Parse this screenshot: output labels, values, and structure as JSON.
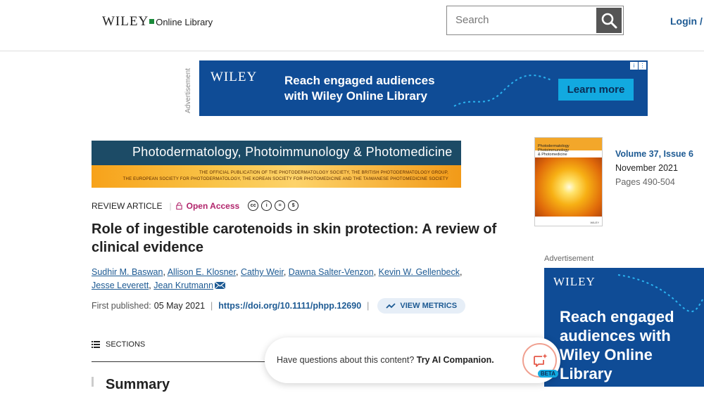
{
  "header": {
    "logo_wiley": "WILEY",
    "logo_sub": "Online Library",
    "search_placeholder": "Search",
    "login": "Login / R"
  },
  "ads": {
    "vertical_label": "Advertisement",
    "top": {
      "brand": "WILEY",
      "headline_line1": "Reach engaged audiences",
      "headline_line2": "with Wiley Online Library",
      "cta": "Learn more"
    },
    "side_label": "Advertisement",
    "side": {
      "brand": "WILEY",
      "headline_line1": "Reach engaged",
      "headline_line2": "audiences with",
      "headline_line3": "Wiley Online",
      "headline_line4": "Library"
    }
  },
  "journal": {
    "banner_title": "Photodermatology, Photoimmunology & Photomedicine",
    "banner_sub1": "THE OFFICIAL PUBLICATION OF THE PHOTODERMATOLOGY SOCIETY, THE BRITISH PHOTODERMATOLOGY GROUP,",
    "banner_sub2": "THE EUROPEAN SOCIETY FOR PHOTODERMATOLOGY, THE KOREAN SOCIETY FOR PHOTOMEDICINE AND THE TAIWANESE PHOTOMEDICINE SOCIETY",
    "cover_line1": "Photodermatology",
    "cover_line2": "Photoimmunology",
    "cover_line3": "& Photomedicine",
    "cover_footer": "WILEY",
    "volume": "Volume 37, Issue 6",
    "month": "November 2021",
    "pages": "Pages 490-504"
  },
  "article": {
    "type": "REVIEW ARTICLE",
    "access": "Open Access",
    "title": "Role of ingestible carotenoids in skin protection: A review of clinical evidence",
    "authors": [
      "Sudhir M. Baswan",
      "Allison E. Klosner",
      "Cathy Weir",
      "Dawna Salter-Venzon",
      "Kevin W. Gellenbeck",
      "Jesse Leverett",
      "Jean Krutmann"
    ],
    "first_published_label": "First published:",
    "first_published_date": "05 May 2021",
    "doi": "https://doi.org/10.1111/phpp.12690",
    "metrics": "VIEW METRICS",
    "sections": "SECTIONS",
    "summary": "Summary"
  },
  "ai": {
    "question": "Have questions about this content?",
    "cta": "Try AI Companion.",
    "beta": "BETA"
  },
  "colors": {
    "link": "#1d5a93",
    "open_access": "#b1246b",
    "ad_bg": "#0f4c96",
    "ad_cta": "#12a9e0"
  }
}
